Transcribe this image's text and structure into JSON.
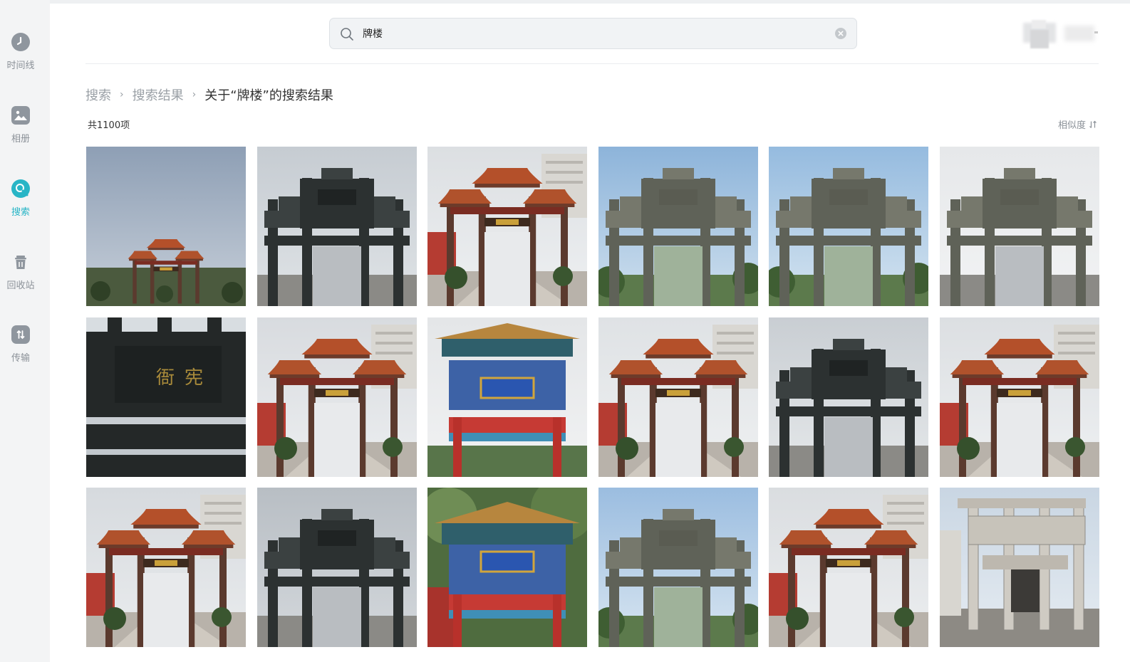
{
  "sidebar": {
    "items": [
      {
        "label": "时间线",
        "icon": "clock-icon"
      },
      {
        "label": "相册",
        "icon": "album-icon"
      },
      {
        "label": "搜索",
        "icon": "search-icon",
        "active": true
      },
      {
        "label": "回收站",
        "icon": "trash-icon"
      },
      {
        "label": "传输",
        "icon": "transfer-icon"
      }
    ]
  },
  "search": {
    "value": "牌楼",
    "placeholder": ""
  },
  "breadcrumb": {
    "root": "搜索",
    "results": "搜索结果",
    "current": "关于“牌楼”的搜索结果"
  },
  "results": {
    "count_label": "共1100项",
    "sort_label": "相似度"
  },
  "colors": {
    "accent": "#28b5c6",
    "sidebar_bg": "#f3f4f5",
    "icon_gray": "#8f969e"
  },
  "photos": [
    {
      "type": "red-paifang-distant",
      "sky": "#8e9fb5",
      "sky2": "#c7cfd9"
    },
    {
      "type": "stone-gate-dark",
      "sky": "#c6ccd2",
      "sky2": "#dfe3e6"
    },
    {
      "type": "red-paifang-street",
      "sky": "#dcdfe2",
      "sky2": "#eef0f2"
    },
    {
      "type": "stone-gate-blue-sky",
      "sky": "#8db4da",
      "sky2": "#cfe0ee"
    },
    {
      "type": "stone-gate-blue-sky",
      "sky": "#95bbdf",
      "sky2": "#d5e4f0"
    },
    {
      "type": "stone-gate-closeup",
      "sky": "#e6e8ea",
      "sky2": "#f2f3f4"
    },
    {
      "type": "stone-lintel-closeup",
      "sky": "#bfc6cc",
      "sky2": "#d8dde1"
    },
    {
      "type": "red-paifang-street",
      "sky": "#d8dbdf",
      "sky2": "#eceef0"
    },
    {
      "type": "painted-arch",
      "sky": "#e4e6e8",
      "sky2": "#f1f2f3"
    },
    {
      "type": "red-paifang-street",
      "sky": "#dfe2e5",
      "sky2": "#eef0f1"
    },
    {
      "type": "stone-gate-dark",
      "sky": "#c9ced3",
      "sky2": "#e5e8ea"
    },
    {
      "type": "red-paifang-street",
      "sky": "#dcdfe2",
      "sky2": "#eef0f2"
    },
    {
      "type": "red-paifang-street",
      "sky": "#d6dade",
      "sky2": "#eaecee"
    },
    {
      "type": "stone-gate-dark",
      "sky": "#b8bec4",
      "sky2": "#d4d8dc"
    },
    {
      "type": "painted-arch-green",
      "sky": "#5e7a4a",
      "sky2": "#8aa06e"
    },
    {
      "type": "stone-gate-blue-sky",
      "sky": "#9bbde0",
      "sky2": "#d9e6f1"
    },
    {
      "type": "red-paifang-street",
      "sky": "#dadde0",
      "sky2": "#eceef0"
    },
    {
      "type": "white-stone-gate",
      "sky": "#c9d6e3",
      "sky2": "#e6ecf2"
    }
  ]
}
